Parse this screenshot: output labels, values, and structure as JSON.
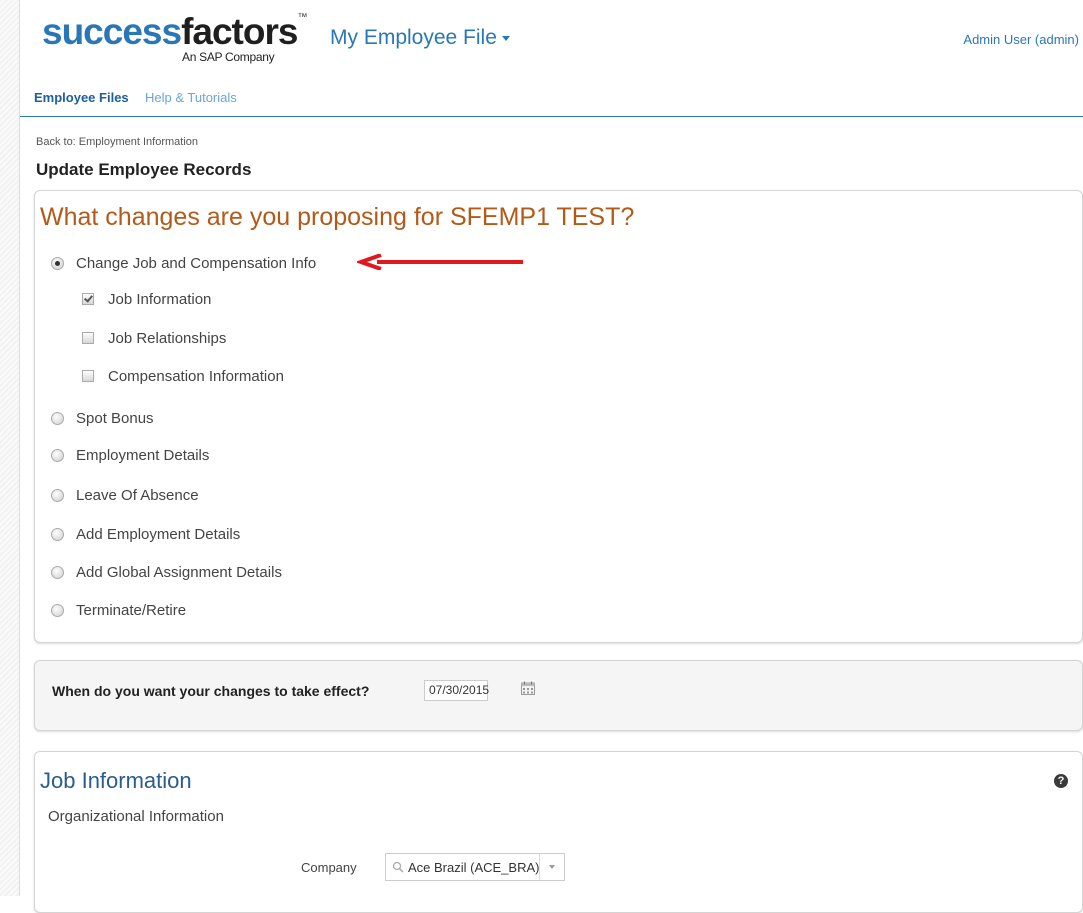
{
  "header": {
    "logo_text_success": "success",
    "logo_text_factors": "factors",
    "logo_tm": "™",
    "logo_tagline": "An SAP Company",
    "app_title": "My Employee File",
    "user": "Admin User (admin)"
  },
  "nav": {
    "tabs": [
      {
        "label": "Employee Files",
        "active": true
      },
      {
        "label": "Help & Tutorials",
        "active": false
      }
    ]
  },
  "breadcrumb": "Back to: Employment Information",
  "page_title": "Update Employee Records",
  "changes_panel": {
    "question": "What changes are you proposing for SFEMP1 TEST?",
    "options": [
      {
        "label": "Change Job and Compensation Info",
        "selected": true
      },
      {
        "label": "Spot Bonus",
        "selected": false
      },
      {
        "label": "Employment Details",
        "selected": false
      },
      {
        "label": "Leave Of Absence",
        "selected": false
      },
      {
        "label": "Add Employment Details",
        "selected": false
      },
      {
        "label": "Add Global Assignment Details",
        "selected": false
      },
      {
        "label": "Terminate/Retire",
        "selected": false
      }
    ],
    "sub_options": [
      {
        "label": "Job Information",
        "checked": true
      },
      {
        "label": "Job Relationships",
        "checked": false
      },
      {
        "label": "Compensation Information",
        "checked": false
      }
    ]
  },
  "effective_date": {
    "label": "When do you want your changes to take effect?",
    "value": "07/30/2015"
  },
  "job_information": {
    "title": "Job Information",
    "section": "Organizational Information",
    "company_label": "Company",
    "company_value": "Ace Brazil (ACE_BRA)"
  },
  "colors": {
    "brand_blue": "#2a77b8",
    "question_orange": "#b35a19",
    "annotation_red": "#e0191e"
  },
  "icons": [
    "calendar-icon",
    "help-icon",
    "search-icon",
    "dropdown-arrow-icon",
    "red-arrow-annotation"
  ]
}
